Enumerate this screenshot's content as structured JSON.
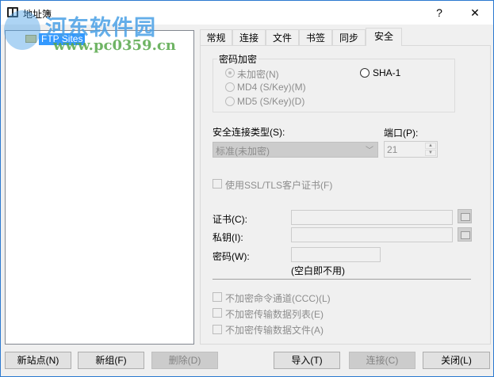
{
  "window": {
    "title": "地址簿",
    "help": "?",
    "close": "✕"
  },
  "tree": {
    "root": "FTP Sites"
  },
  "tabs": [
    "常规",
    "连接",
    "文件",
    "书签",
    "同步",
    "安全"
  ],
  "security": {
    "group_label": "密码加密",
    "radios": {
      "none": "未加密(N)",
      "md4": "MD4 (S/Key)(M)",
      "md5": "MD5 (S/Key)(D)",
      "sha1": "SHA-1"
    },
    "conn_type_label": "安全连接类型(S):",
    "conn_type_value": "标准(未加密)",
    "port_label": "端口(P):",
    "port_value": "21",
    "ssl_cert_label": "使用SSL/TLS客户证书(F)",
    "cert_label": "证书(C):",
    "key_label": "私钥(I):",
    "password_label": "密码(W):",
    "password_hint": "(空白即不用)",
    "opt_ccc": "不加密命令通道(CCC)(L)",
    "opt_list": "不加密传输数据列表(E)",
    "opt_file": "不加密传输数据文件(A)"
  },
  "buttons": {
    "new_site": "新站点(N)",
    "new_group": "新组(F)",
    "delete": "删除(D)",
    "import": "导入(T)",
    "connect": "连接(C)",
    "close": "关闭(L)"
  },
  "watermark": {
    "name": "河东软件园",
    "url": "www.pc0359.cn"
  }
}
